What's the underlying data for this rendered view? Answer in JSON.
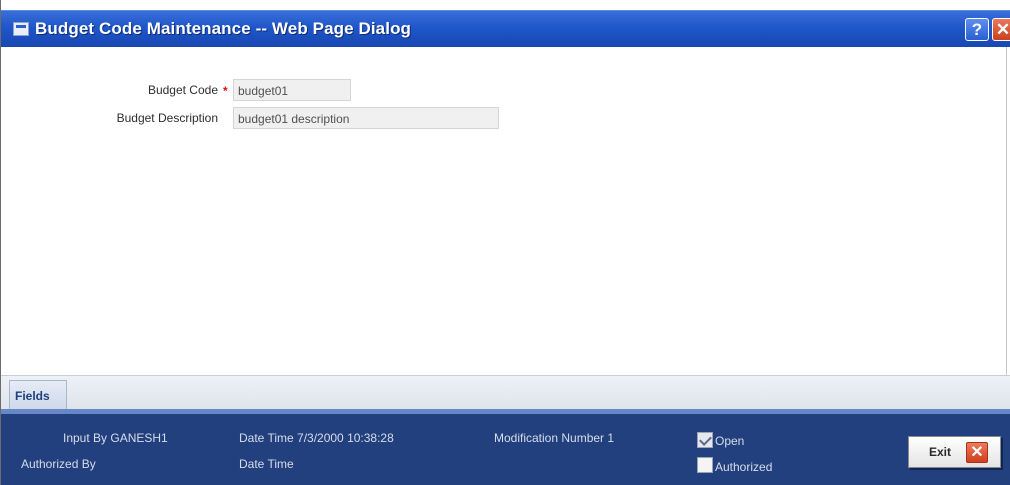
{
  "window": {
    "title": "Budget Code Maintenance -- Web Page Dialog",
    "help_glyph": "?",
    "close_glyph": "✕",
    "title_icon": "dialog-icon",
    "colors": {
      "titlebar": "#1f56c9",
      "footer": "#22407e",
      "required": "#e01010"
    }
  },
  "form": {
    "budget_code": {
      "label": "Budget Code",
      "required_mark": "*",
      "value": "budget01"
    },
    "budget_description": {
      "label": "Budget Description",
      "value": "budget01 description"
    }
  },
  "tabs": [
    {
      "label": "Fields"
    }
  ],
  "footer": {
    "input_by": "Input By GANESH1",
    "authorized_by": "Authorized By",
    "date_time_input": "Date Time 7/3/2000 10:38:28",
    "date_time_auth": "Date Time",
    "modification_number": "Modification Number 1",
    "open": {
      "label": "Open",
      "checked": true
    },
    "authorized": {
      "label": "Authorized",
      "checked": false
    },
    "exit_label": "Exit",
    "exit_glyph": "✕"
  }
}
